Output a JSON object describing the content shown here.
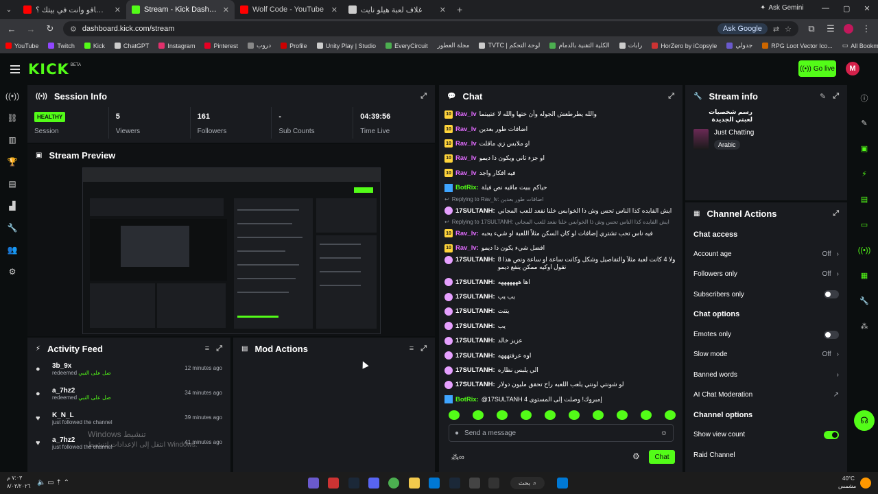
{
  "browser": {
    "tabs": [
      {
        "title": "كيف تساقو وانت في بيتك ؟ - be",
        "fav": "#ff0000",
        "close": "✕"
      },
      {
        "title": "Stream - Kick Dashboard",
        "fav": "#53fc18",
        "close": "✕"
      },
      {
        "title": "Wolf Code - YouTube",
        "fav": "#ff0000",
        "close": "✕"
      },
      {
        "title": "غلاف لعبة هيلو نايت",
        "fav": "#cccccc",
        "close": "✕"
      }
    ],
    "new_tab": "+",
    "ask_gemini": "Ask Gemini",
    "url": "dashboard.kick.com/stream",
    "ask_google": "Ask Google",
    "bookmarks": [
      {
        "label": "YouTube",
        "color": "#ff0000"
      },
      {
        "label": "Twitch",
        "color": "#9146ff"
      },
      {
        "label": "Kick",
        "color": "#53fc18"
      },
      {
        "label": "ChatGPT",
        "color": "#cccccc"
      },
      {
        "label": "Instagram",
        "color": "#e1306c"
      },
      {
        "label": "Pinterest",
        "color": "#e60023"
      },
      {
        "label": "دروب",
        "color": "#888888"
      },
      {
        "label": "Profile",
        "color": "#cc0000"
      },
      {
        "label": "Unity Play | Studio",
        "color": "#cccccc"
      },
      {
        "label": "EveryCircuit",
        "color": "#4caf50"
      },
      {
        "label": "مجلة العطور",
        "color": "#aaaaaa"
      },
      {
        "label": "TVTC | لوحة التحكم",
        "color": "#cccccc"
      },
      {
        "label": "الكلية التقنية بالدمام",
        "color": "#4caf50"
      },
      {
        "label": "رابات",
        "color": "#cccccc"
      },
      {
        "label": "HorZero by iCopsyle",
        "color": "#cc3333"
      },
      {
        "label": "جدولي",
        "color": "#6a5acd"
      },
      {
        "label": "RPG Loot Vector Ico...",
        "color": "#cc6600"
      }
    ],
    "all_bookmarks": "All Bookmarks"
  },
  "kick": {
    "logo": "KICK",
    "beta": "BETA",
    "go_live": "Go live",
    "avatar_letter": "M"
  },
  "session": {
    "title": "Session Info",
    "status": "HEALTHY",
    "status_label": "Session",
    "stats": [
      {
        "value": "5",
        "label": "Viewers"
      },
      {
        "value": "161",
        "label": "Followers"
      },
      {
        "value": "-",
        "label": "Sub Counts"
      },
      {
        "value": "04:39:56",
        "label": "Time Live"
      }
    ]
  },
  "preview": {
    "title": "Stream Preview"
  },
  "activity": {
    "title": "Activity Feed",
    "items": [
      {
        "name": "3b_9x",
        "action": "redeemed",
        "reward": "صل على النبي",
        "time": "12 minutes ago"
      },
      {
        "name": "a_7hz2",
        "action": "redeemed",
        "reward": "صل على النبي",
        "time": "34 minutes ago"
      },
      {
        "name": "K_N_L",
        "action": "just followed the channel",
        "reward": "",
        "time": "39 minutes ago"
      },
      {
        "name": "a_7hz2",
        "action": "just followed the channel",
        "reward": "",
        "time": "41 minutes ago"
      }
    ]
  },
  "mod": {
    "title": "Mod Actions"
  },
  "chat": {
    "title": "Chat",
    "messages": [
      {
        "badge": "10",
        "user": "Rav_lv",
        "cls": "rav",
        "text": "والله يطرطعش الجوله وأن ختها والله لا عتيبتما"
      },
      {
        "badge": "10",
        "user": "Rav_lv",
        "cls": "rav",
        "text": "اضافات طور بعدين"
      },
      {
        "badge": "10",
        "user": "Rav_lv",
        "cls": "rav",
        "text": "او ملابس زي ماقلت"
      },
      {
        "badge": "10",
        "user": "Rav_lv",
        "cls": "rav",
        "text": "او جزء ثاني ويكون ذا ديمو"
      },
      {
        "badge": "10",
        "user": "Rav_lv",
        "cls": "rav",
        "text": "فيه افكار واجد"
      },
      {
        "badge": "bot",
        "user": "BotRix:",
        "cls": "bot",
        "text": "حياكم ببيت ماقيه نص فيلة"
      },
      {
        "reply": "Replying to Rav_lv: اضافات طور بعدين"
      },
      {
        "badge": "s",
        "user": "17SULTANH:",
        "cls": "sul",
        "text": "ايش الفايده كذا الناس تحس وش ذا الخوابس خلنا نفعد للعب المجاني"
      },
      {
        "reply": "Replying to 17SULTANH: ايش الفايده كذا الناس تحس وش ذا الخوابس خلنا نفعد للعب المجاني"
      },
      {
        "badge": "10",
        "user": "Rav_lv:",
        "cls": "rav",
        "text": "فيه ناس تحب تشتري إضافات لو كان السكن مثلاً اللعبة او شيء يحبه"
      },
      {
        "badge": "10",
        "user": "Rav_lv:",
        "cls": "rav",
        "text": "افضل شيء يكون ذا ديمو"
      },
      {
        "badge": "s",
        "user": "17SULTANH:",
        "cls": "sul",
        "text": "8 ولا 4 كانت لعبة مثلاً والتفاصيل وشكل وكانت ساعة او ساعة ونص هذا تقول اوكيه ممكن ينفع ديمو",
        "tall": true
      },
      {
        "badge": "s",
        "user": "17SULTANH:",
        "cls": "sul",
        "text": "اها هههههههه"
      },
      {
        "badge": "s",
        "user": "17SULTANH:",
        "cls": "sul",
        "text": "يب يب"
      },
      {
        "badge": "s",
        "user": "17SULTANH:",
        "cls": "sul",
        "text": "يتتت"
      },
      {
        "badge": "s",
        "user": "17SULTANH:",
        "cls": "sul",
        "text": "يب"
      },
      {
        "badge": "s",
        "user": "17SULTANH:",
        "cls": "sul",
        "text": "عزيز خالد"
      },
      {
        "badge": "s",
        "user": "17SULTANH:",
        "cls": "sul",
        "text": "اوه عرفتهههه"
      },
      {
        "badge": "s",
        "user": "17SULTANH:",
        "cls": "sul",
        "text": "الي يلبس نظاره"
      },
      {
        "badge": "s",
        "user": "17SULTANH:",
        "cls": "sul",
        "text": "لو شونتي لونتي يلعب اللعبه راح تحقق مليون دولار"
      },
      {
        "badge": "bot",
        "user": "BotRix:",
        "cls": "bot",
        "text": "@17SULTANH 4 إمبروك! وصلت إلى المستوى"
      }
    ],
    "input_placeholder": "Send a message",
    "send": "Chat",
    "infinity": "∞"
  },
  "stream_info": {
    "title": "Stream info",
    "stream_title": "رسم شخصيات لعبتي الجديدة",
    "category": "Just Chatting",
    "tag": "Arabic"
  },
  "channel_actions": {
    "title": "Channel Actions",
    "chat_access": "Chat access",
    "account_age": "Account age",
    "account_age_val": "Off",
    "followers_only": "Followers only",
    "followers_only_val": "Off",
    "subscribers_only": "Subscribers only",
    "chat_options": "Chat options",
    "emotes_only": "Emotes only",
    "slow_mode": "Slow mode",
    "slow_mode_val": "Off",
    "banned_words": "Banned words",
    "ai_mod": "AI Chat Moderation",
    "channel_options": "Channel options",
    "show_view_count": "Show view count",
    "raid_channel": "Raid Channel"
  },
  "desktop": {
    "watermark1": "Windows تنشيط",
    "watermark2": "انتقل إلى الإعدادات لتنشيط Windows.",
    "time": "٧:٠٣ م",
    "date": "٨/٠٣/٢٠٢٦",
    "temp": "40°C",
    "weather": "مشمس",
    "search": "بحث"
  }
}
